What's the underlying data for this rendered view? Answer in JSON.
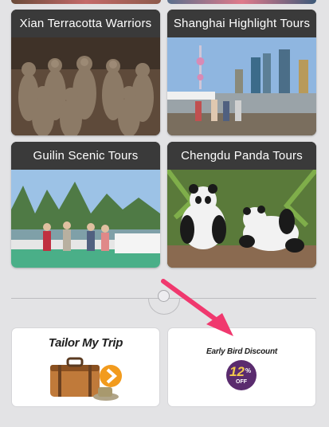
{
  "tours": [
    {
      "title": "Xian Terracotta Warriors"
    },
    {
      "title": "Shanghai Highlight Tours"
    },
    {
      "title": "Guilin Scenic Tours"
    },
    {
      "title": "Chengdu Panda Tours"
    }
  ],
  "promos": {
    "tailor": {
      "title": "Tailor My Trip"
    },
    "early_bird": {
      "title": "Early Bird Discount",
      "badge_value": "12",
      "badge_pct": "%",
      "badge_off": "OFF"
    }
  },
  "colors": {
    "arrow": "#f0386e",
    "badge": "#5a2b6e",
    "card_title_bg": "#3a3a3a"
  },
  "icons": [
    "suitcase-icon",
    "chevron-right-icon",
    "discount-badge-icon",
    "pointer-arrow-icon"
  ]
}
